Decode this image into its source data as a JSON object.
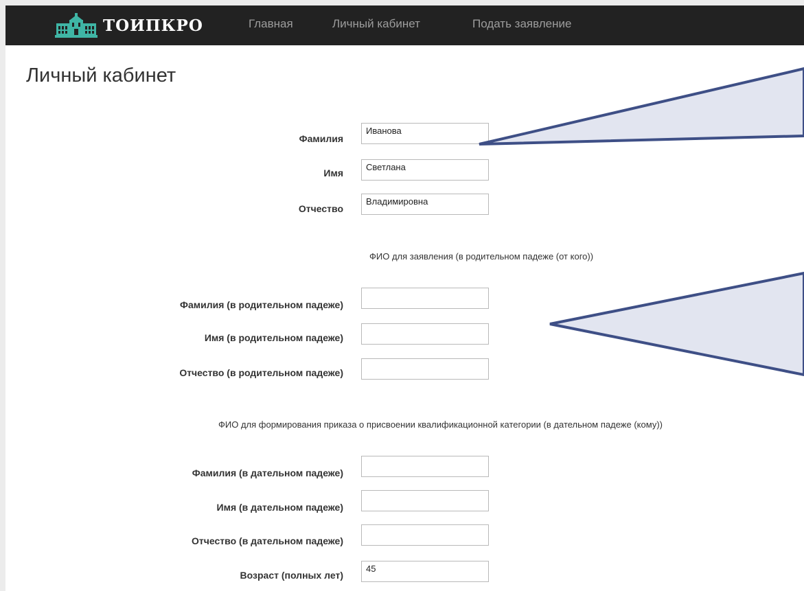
{
  "brand": {
    "name": "ТОИПКРО",
    "logo_icon": "building-logo-icon",
    "accent": "#3fb5a5"
  },
  "nav": [
    {
      "label": "Главная"
    },
    {
      "label": "Личный кабинет"
    },
    {
      "label": "Подать заявление"
    }
  ],
  "page": {
    "title": "Личный кабинет"
  },
  "main_fields": [
    {
      "label": "Фамилия",
      "value": "Иванова"
    },
    {
      "label": "Имя",
      "value": "Светлана"
    },
    {
      "label": "Отчество",
      "value": "Владимировна"
    }
  ],
  "genitive": {
    "caption": "ФИО для заявления (в родительном падеже (от кого))",
    "fields": [
      {
        "label": "Фамилия (в родительном падеже)",
        "value": ""
      },
      {
        "label": "Имя (в родительном падеже)",
        "value": ""
      },
      {
        "label": "Отчество (в родительном падеже)",
        "value": ""
      }
    ]
  },
  "dative": {
    "caption": "ФИО для формирования приказа о присвоении квалификационной категории (в дательном падеже (кому))",
    "fields": [
      {
        "label": "Фамилия (в дательном падеже)",
        "value": ""
      },
      {
        "label": "Имя (в дательном падеже)",
        "value": ""
      },
      {
        "label": "Отчество (в дательном падеже)",
        "value": ""
      }
    ]
  },
  "age": {
    "label": "Возраст (полных лет)",
    "value": "45"
  },
  "colors": {
    "navbar": "#222222",
    "nav_link": "#9d9d9d",
    "callout_fill": "#e2e5f0",
    "callout_stroke": "#3e4f86"
  }
}
